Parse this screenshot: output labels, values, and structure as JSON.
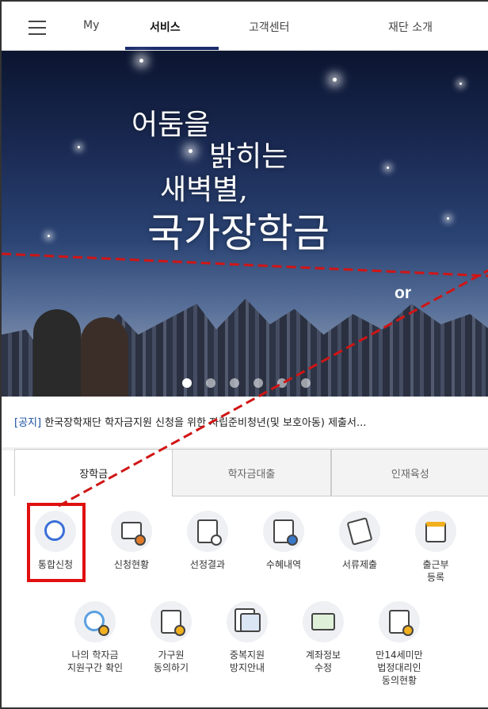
{
  "nav": {
    "items": [
      {
        "label": "My"
      },
      {
        "label": "서비스"
      },
      {
        "label": "고객센터"
      },
      {
        "label": "재단 소개"
      }
    ],
    "active_index": 1
  },
  "hero": {
    "line1": "어둠을",
    "line2": "밝히는",
    "line3": "새벽별,",
    "line4": "국가장학금",
    "slide_count": 6,
    "active_slide": 0
  },
  "notice": {
    "tag": "[공지]",
    "text": " 한국장학재단 학자금지원 신청을 위한 자립준비청년(및 보호아동) 제출서..."
  },
  "tabs": [
    {
      "label": "장학금"
    },
    {
      "label": "학자금대출"
    },
    {
      "label": "인재육성"
    }
  ],
  "grid": {
    "row1": [
      {
        "label": "통합신청",
        "icon": "cursor-click-icon"
      },
      {
        "label": "신청현황",
        "icon": "presentation-board-icon"
      },
      {
        "label": "선정결과",
        "icon": "magnifier-document-icon"
      },
      {
        "label": "수혜내역",
        "icon": "money-document-icon"
      },
      {
        "label": "서류제출",
        "icon": "document-submit-icon"
      },
      {
        "label": "출근부\n등록",
        "icon": "calendar-icon"
      }
    ],
    "row2": [
      {
        "label": "나의 학자금\n지원구간 확인",
        "icon": "coins-magnifier-icon"
      },
      {
        "label": "가구원\n동의하기",
        "icon": "document-check-icon"
      },
      {
        "label": "중복지원\n방지안내",
        "icon": "duplicate-documents-icon"
      },
      {
        "label": "계좌정보\n수정",
        "icon": "bank-card-icon"
      },
      {
        "label": "만14세미만\n법정대리인\n동의현황",
        "icon": "document-consent-icon"
      }
    ]
  },
  "annotation": {
    "or_label": "or",
    "highlight_color": "#e01010"
  },
  "colors": {
    "nav_active_underline": "#1a2c6b",
    "notice_tag": "#1a4fa0"
  }
}
